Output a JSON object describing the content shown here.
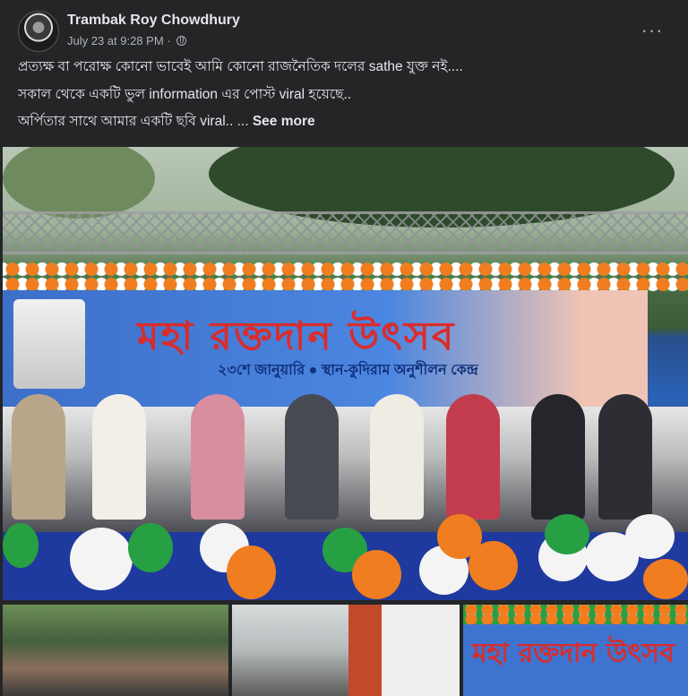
{
  "post": {
    "author": "Trambak Roy Chowdhury",
    "timestamp": "July 23 at 9:28 PM",
    "separator": "·",
    "privacy_icon": "globe-icon",
    "more_icon": "more-options-icon",
    "more_label": "···",
    "text_lines": [
      "প্রত্যক্ষ বা পরোক্ষ কোনো ভাবেই আমি কোনো রাজনৈতিক দলের sathe যুক্ত নই....",
      "সকাল থেকে একটি ভুল information এর পোস্ট viral হয়েছে..",
      "অর্পিতার সাথে আমার একটি ছবি viral.. ..."
    ],
    "see_more_label": "See more"
  },
  "main_photo": {
    "banner_title": "মহা রক্তদান উৎসব",
    "banner_subtitle": "২৩শে জানুয়ারি ● স্থান-কুদিরাম অনুশীলন কেন্দ্র"
  },
  "thumbnails": {
    "thumb3_title": "মহা রক্তদান উৎসব"
  },
  "colors": {
    "background": "#242526",
    "primary_text": "#e4e6eb",
    "secondary_text": "#b0b3b8"
  }
}
